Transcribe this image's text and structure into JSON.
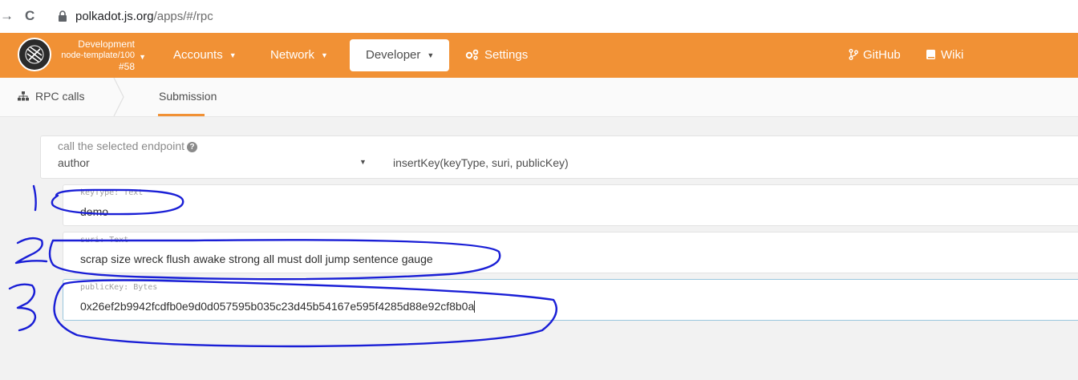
{
  "browser": {
    "back_glyph": "→",
    "reload_glyph": "C",
    "url_host": "polkadot.js.org",
    "url_path": "/apps/#/rpc"
  },
  "header": {
    "chain_line1": "Development",
    "chain_line2": "node-template/100",
    "chain_line3": "#58",
    "menu": [
      {
        "label": "Accounts"
      },
      {
        "label": "Network"
      },
      {
        "label": "Developer"
      },
      {
        "label": "Settings"
      }
    ],
    "github": "GitHub",
    "wiki": "Wiki",
    "brand_color": "#f19135"
  },
  "tabs": {
    "rpc_calls": "RPC calls",
    "submission": "Submission"
  },
  "form": {
    "endpoint_label": "call the selected endpoint",
    "help_glyph": "?",
    "section": "author",
    "method": "insertKey(keyType, suri, publicKey)",
    "params": [
      {
        "label": "keyType: Text",
        "value": "demo"
      },
      {
        "label": "suri: Text",
        "value": "scrap size wreck flush awake strong all must doll jump sentence gauge"
      },
      {
        "label": "publicKey: Bytes",
        "value": "0x26ef2b9942fcdfb0e9d0d057595b035c23d45b54167e595f4285d88e92cf8b0a"
      }
    ]
  },
  "annotations": {
    "numbers": [
      "1",
      "2",
      "3"
    ],
    "ink_color": "#1a1fd6"
  }
}
